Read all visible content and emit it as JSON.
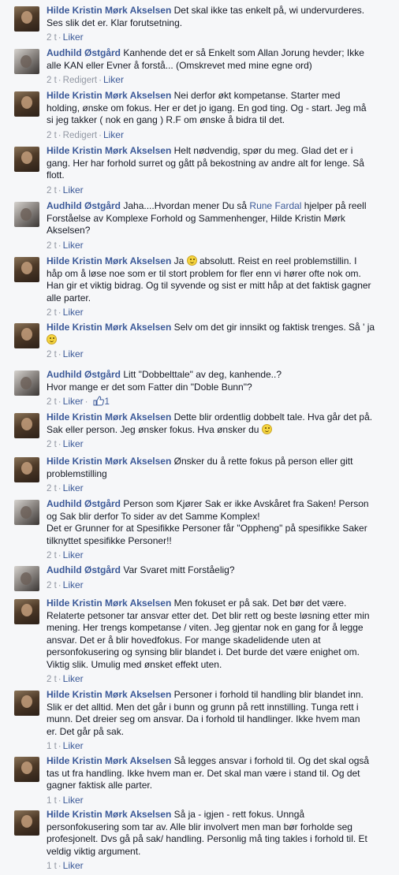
{
  "comments": [
    {
      "author": "Hilde Kristin Mørk Akselsen",
      "avatar": "hilde",
      "time": "2 t",
      "edited": "",
      "like": "Liker",
      "likes": "",
      "text": [
        {
          "t": "Det skal ikke tas enkelt på, wi undervurderes."
        },
        {
          "br": true
        },
        {
          "t": "Ses slik det er. Klar forutsetning."
        }
      ]
    },
    {
      "author": "Audhild Østgård",
      "avatar": "audhild",
      "time": "2 t",
      "edited": "Redigert",
      "like": "Liker",
      "likes": "",
      "text": [
        {
          "t": "Kanhende det er så Enkelt som Allan Jorung hevder; Ikke"
        },
        {
          "br": true
        },
        {
          "t": "alle KAN eller Evner å forstå... (Omskrevet med mine egne ord)"
        }
      ]
    },
    {
      "author": "Hilde Kristin Mørk Akselsen",
      "avatar": "hilde",
      "time": "2 t",
      "edited": "Redigert",
      "like": "Liker",
      "likes": "",
      "text": [
        {
          "t": "Nei derfor økt kompetanse. Starter med"
        },
        {
          "br": true
        },
        {
          "t": "holding, ønske om fokus. Her er det jo igang. En god ting. Og - start. Jeg må"
        },
        {
          "br": true
        },
        {
          "t": "si jeg takker ( nok en gang ) R.F om ønske å bidra til det."
        }
      ]
    },
    {
      "author": "Hilde Kristin Mørk Akselsen",
      "avatar": "hilde",
      "time": "2 t",
      "edited": "",
      "like": "Liker",
      "likes": "",
      "text": [
        {
          "t": "Helt nødvendig, spør du meg. Glad det er i"
        },
        {
          "br": true
        },
        {
          "t": "gang. Her har forhold surret og gått på bekostning av andre alt for lenge. Så"
        },
        {
          "br": true
        },
        {
          "t": "flott."
        }
      ]
    },
    {
      "author": "Audhild Østgård",
      "avatar": "audhild",
      "time": "2 t",
      "edited": "",
      "like": "Liker",
      "likes": "",
      "text": [
        {
          "t": "Jaha....Hvordan mener Du så "
        },
        {
          "m": "Rune Fardal"
        },
        {
          "t": " hjelper på reell"
        },
        {
          "br": true
        },
        {
          "t": "Forståelse av Komplexe Forhold og Sammenhenger, Hilde Kristin Mørk"
        },
        {
          "br": true
        },
        {
          "t": "Akselsen?"
        }
      ]
    },
    {
      "author": "Hilde Kristin Mørk Akselsen",
      "avatar": "hilde",
      "time": "2 t",
      "edited": "",
      "like": "Liker",
      "likes": "",
      "text": [
        {
          "t": "Ja "
        },
        {
          "e": "smile-emoticon"
        },
        {
          "t": " absolutt. Reist en reel problemstillin. I"
        },
        {
          "br": true
        },
        {
          "t": "håp om å løse noe som er til stort problem for fler enn vi hører ofte nok om."
        },
        {
          "br": true
        },
        {
          "t": "Han gir et viktig bidrag. Og til syvende og sist er mitt håp at det faktisk gagner"
        },
        {
          "br": true
        },
        {
          "t": "alle parter."
        }
      ]
    },
    {
      "author": "Hilde Kristin Mørk Akselsen",
      "avatar": "hilde",
      "time": "2 t",
      "edited": "",
      "like": "Liker",
      "likes": "",
      "text": [
        {
          "t": "Selv om det gir innsikt og faktisk trenges. Så ' ja"
        },
        {
          "br": true
        },
        {
          "e": "smile-emoticon"
        }
      ]
    },
    {
      "author": "Audhild Østgård",
      "avatar": "audhild",
      "time": "2 t",
      "edited": "",
      "like": "Liker",
      "likes": "1",
      "text": [
        {
          "t": "Litt \"Dobbelttale\" av deg, kanhende..?"
        },
        {
          "br": true
        },
        {
          "t": "Hvor mange er det som Fatter din \"Doble Bunn\"?"
        }
      ]
    },
    {
      "author": "Hilde Kristin Mørk Akselsen",
      "avatar": "hilde",
      "time": "2 t",
      "edited": "",
      "like": "Liker",
      "likes": "",
      "text": [
        {
          "t": "Dette blir ordentlig dobbelt tale. Hva går det på."
        },
        {
          "br": true
        },
        {
          "t": "Sak eller person. Jeg ønsker fokus. Hva ønsker du "
        },
        {
          "e": "smile-emoticon"
        }
      ]
    },
    {
      "author": "Hilde Kristin Mørk Akselsen",
      "avatar": "hilde",
      "time": "2 t",
      "edited": "",
      "like": "Liker",
      "likes": "",
      "text": [
        {
          "t": "Ønsker du å rette fokus på person eller gitt"
        },
        {
          "br": true
        },
        {
          "t": "problemstilling"
        }
      ]
    },
    {
      "author": "Audhild Østgård",
      "avatar": "audhild",
      "time": "2 t",
      "edited": "",
      "like": "Liker",
      "likes": "",
      "text": [
        {
          "t": "Person som Kjører Sak er ikke Avskåret fra Saken! Person"
        },
        {
          "br": true
        },
        {
          "t": "og Sak blir derfor To sider av det Samme Komplex!"
        },
        {
          "br": true
        },
        {
          "t": "Det er Grunner for at Spesifikke Personer får \"Oppheng\" på spesifikke Saker"
        },
        {
          "br": true
        },
        {
          "t": "tilknyttet spesifikke Personer!!"
        }
      ]
    },
    {
      "author": "Audhild Østgård",
      "avatar": "audhild",
      "time": "2 t",
      "edited": "",
      "like": "Liker",
      "likes": "",
      "text": [
        {
          "t": "Var Svaret mitt Forståelig?"
        }
      ]
    },
    {
      "author": "Hilde Kristin Mørk Akselsen",
      "avatar": "hilde",
      "time": "2 t",
      "edited": "",
      "like": "Liker",
      "likes": "",
      "text": [
        {
          "t": "Men fokuset er på sak. Det bør det være."
        },
        {
          "br": true
        },
        {
          "t": "Relaterte petsoner tar ansvar etter det. Det blir rett og beste løsning etter min"
        },
        {
          "br": true
        },
        {
          "t": "mening. Her trengs kompetanse / viten. Jeg gjentar nok en gang for å legge"
        },
        {
          "br": true
        },
        {
          "t": "ansvar. Det er å blir hovedfokus. For mange skadelidende uten at"
        },
        {
          "br": true
        },
        {
          "t": "personfokusering og synsing blir blandet i. Det burde det være enighet om."
        },
        {
          "br": true
        },
        {
          "t": "Viktig slik. Umulig med ønsket effekt uten."
        }
      ]
    },
    {
      "author": "Hilde Kristin Mørk Akselsen",
      "avatar": "hilde",
      "time": "1 t",
      "edited": "",
      "like": "Liker",
      "likes": "",
      "text": [
        {
          "t": "Personer i forhold til handling blir blandet inn."
        },
        {
          "br": true
        },
        {
          "t": "Slik er det alltid. Men det går i bunn og grunn på rett innstilling. Tunga rett i"
        },
        {
          "br": true
        },
        {
          "t": "munn. Det dreier seg om ansvar. Da i forhold til handlinger. Ikke hvem man"
        },
        {
          "br": true
        },
        {
          "t": "er. Det går på sak."
        }
      ]
    },
    {
      "author": "Hilde Kristin Mørk Akselsen",
      "avatar": "hilde",
      "time": "1 t",
      "edited": "",
      "like": "Liker",
      "likes": "",
      "text": [
        {
          "t": "Så legges ansvar i forhold til. Og det skal også"
        },
        {
          "br": true
        },
        {
          "t": "tas ut fra handling. Ikke hvem man er. Det skal man være i stand til. Og det"
        },
        {
          "br": true
        },
        {
          "t": "gagner faktisk alle parter."
        }
      ]
    },
    {
      "author": "Hilde Kristin Mørk Akselsen",
      "avatar": "hilde",
      "time": "1 t",
      "edited": "",
      "like": "Liker",
      "likes": "",
      "text": [
        {
          "t": "Så ja - igjen - rett fokus. Unngå"
        },
        {
          "br": true
        },
        {
          "t": "personfokusering som tar av. Alle blir involvert men man bør forholde seg"
        },
        {
          "br": true
        },
        {
          "t": "profesjonelt. Dvs gå på sak/ handling. Personlig må ting takles i forhold til. Et"
        },
        {
          "br": true
        },
        {
          "t": "veldig viktig argument."
        }
      ]
    }
  ]
}
